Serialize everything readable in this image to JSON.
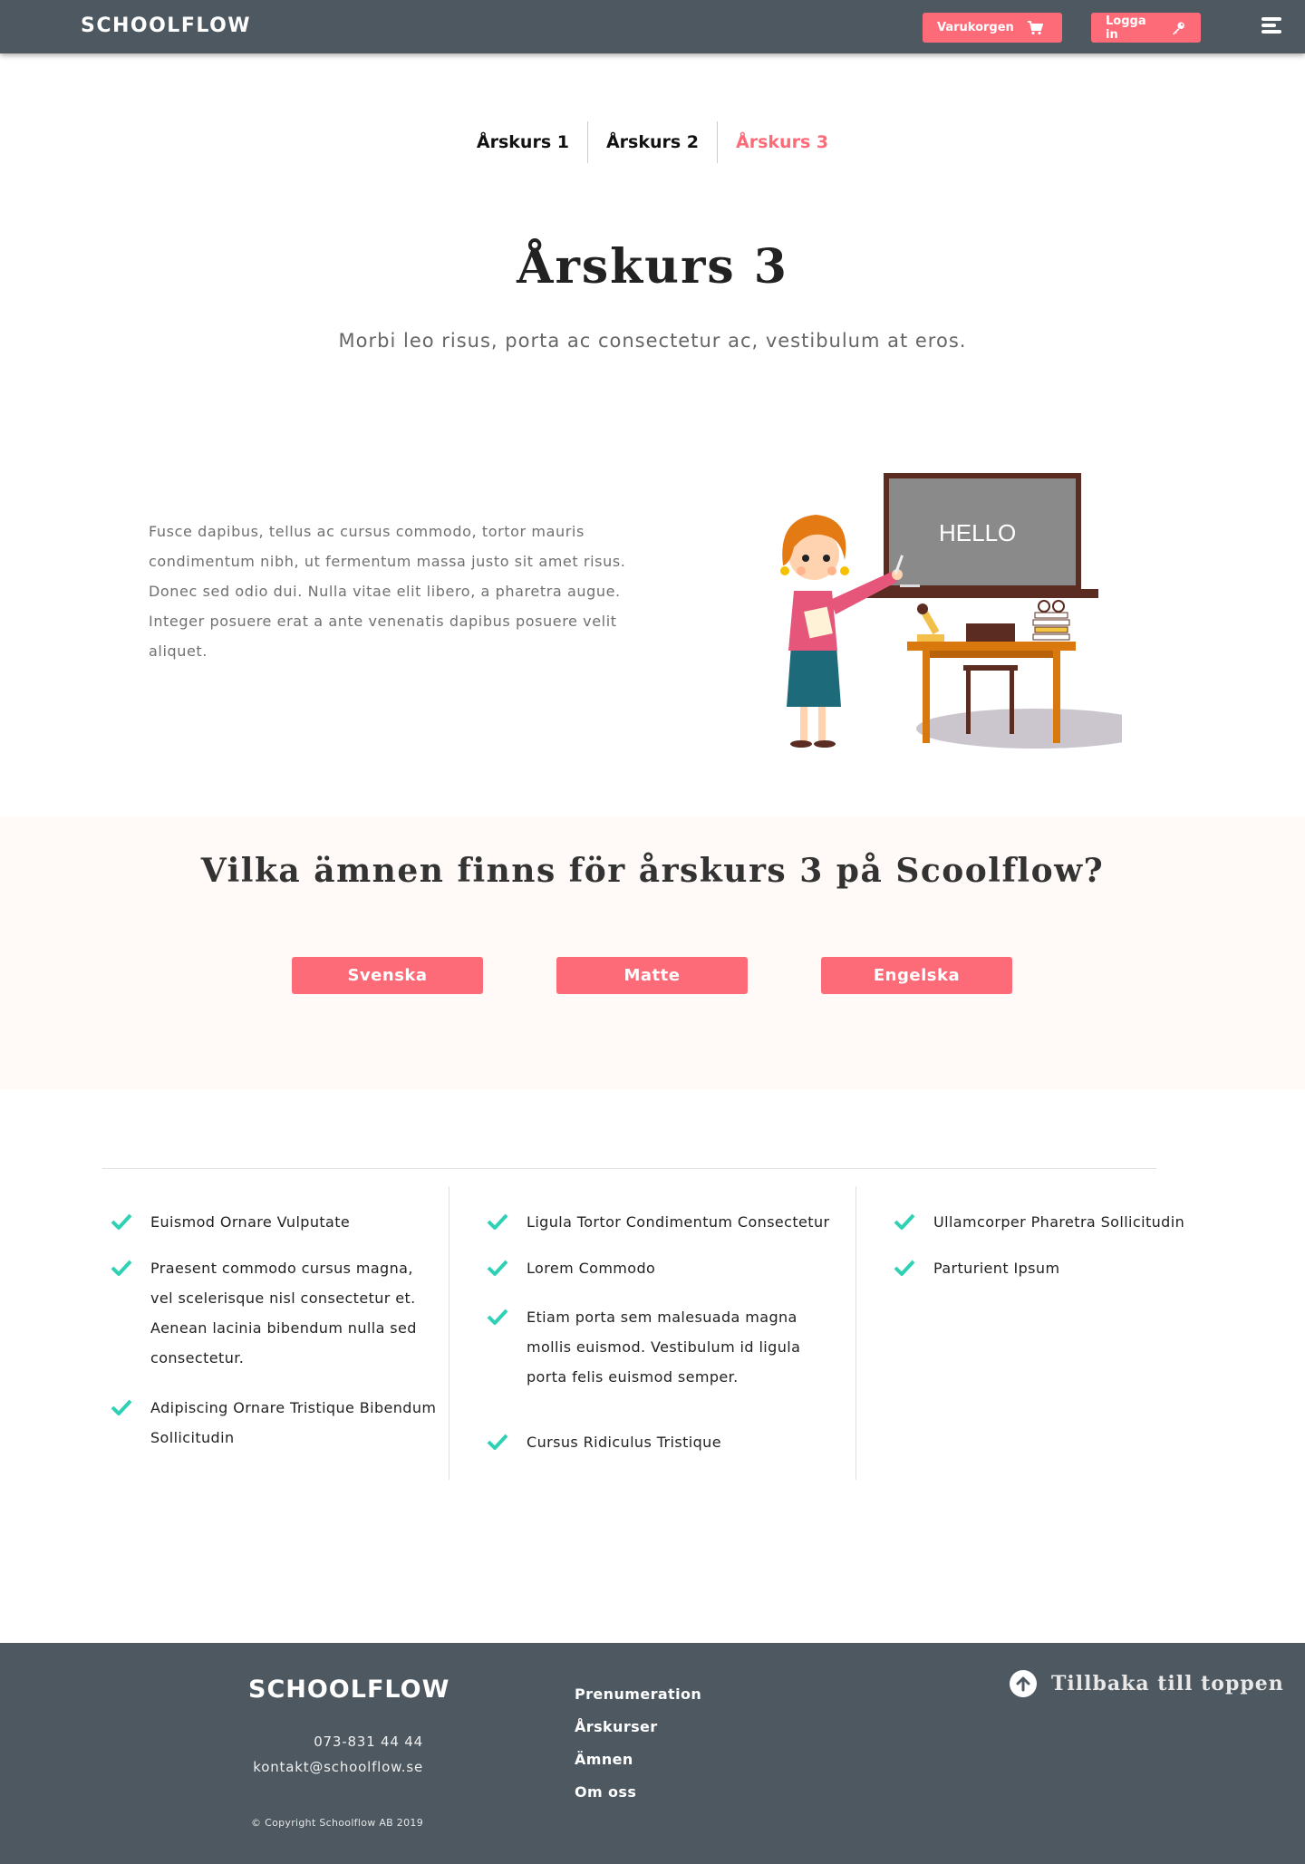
{
  "header": {
    "logo": "SCHOOLFLOW",
    "cart_label": "Varukorgen",
    "login_label": "Logga in",
    "cart_icon": "cart-icon",
    "login_icon": "key-icon",
    "menu_icon": "hamburger-menu-icon"
  },
  "tabs": [
    {
      "label": "Årskurs 1",
      "active": false
    },
    {
      "label": "Årskurs 2",
      "active": false
    },
    {
      "label": "Årskurs 3",
      "active": true
    }
  ],
  "hero": {
    "title": "Årskurs 3",
    "subtitle": "Morbi leo risus, porta ac consectetur ac, vestibulum at eros."
  },
  "intro": {
    "text": "Fusce dapibus, tellus ac cursus commodo, tortor mauris condimentum nibh, ut fermentum massa justo sit amet risus. Donec sed odio dui. Nulla vitae elit libero, a pharetra augue. Integer posuere erat a ante venenatis dapibus posuere velit aliquet.",
    "chalkboard_text": "HELLO"
  },
  "subjects": {
    "title": "Vilka ämnen finns för årskurs 3 på Scoolflow?",
    "buttons": [
      "Svenska",
      "Matte",
      "Engelska"
    ]
  },
  "features": {
    "col1": [
      "Euismod Ornare Vulputate",
      "Praesent commodo cursus magna, vel scelerisque nisl consectetur et. Aenean lacinia bibendum nulla sed consectetur.",
      "Adipiscing Ornare Tristique Bibendum Sollicitudin"
    ],
    "col2": [
      "Ligula Tortor Condimentum Consectetur",
      "Lorem Commodo",
      "Etiam porta sem malesuada magna mollis euismod. Vestibulum id ligula porta felis euismod semper.",
      "Cursus Ridiculus Tristique"
    ],
    "col3": [
      "Ullamcorper Pharetra Sollicitudin",
      "Parturient Ipsum"
    ],
    "check_color": "#2fd1b5"
  },
  "footer": {
    "logo": "SCHOOLFLOW",
    "phone": "073-831 44 44",
    "email": "kontakt@schoolflow.se",
    "copyright": "© Copyright Schoolflow AB 2019",
    "links": [
      "Prenumeration",
      "Årskurser",
      "Ämnen",
      "Om oss"
    ],
    "back_to_top": "Tillbaka till toppen"
  },
  "colors": {
    "accent": "#fe6b78",
    "header_bg": "#4d5860",
    "band_bg": "#fffaf7",
    "check": "#2fd1b5"
  }
}
